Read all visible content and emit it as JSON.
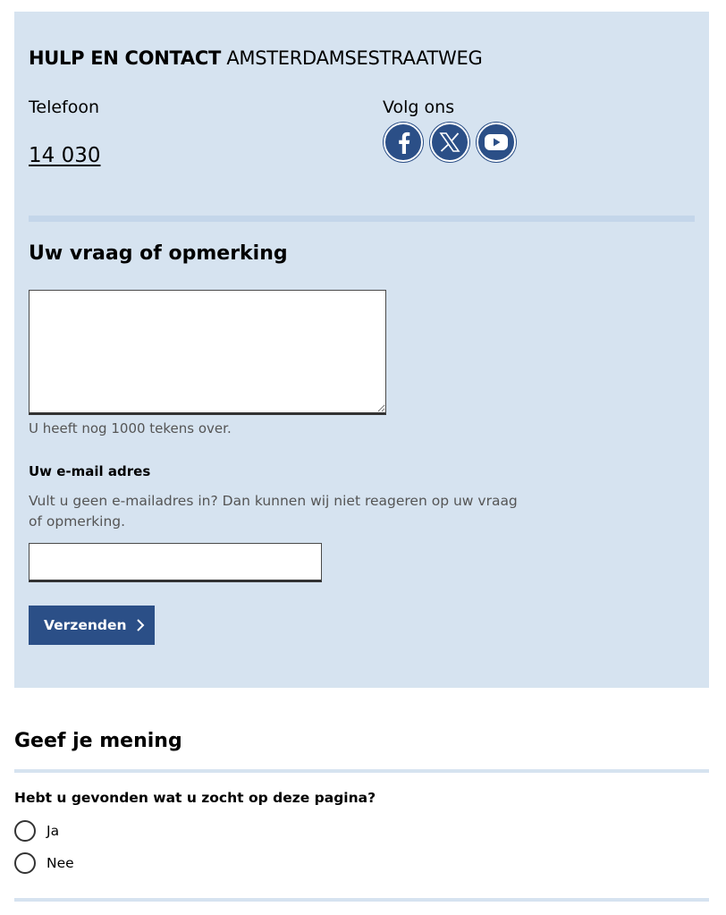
{
  "contact": {
    "title_bold": "HULP EN CONTACT",
    "title_location": "AMSTERDAMSESTRAATWEG",
    "phone_label": "Telefoon",
    "phone_number": "14 030",
    "follow_label": "Volg ons",
    "social": [
      {
        "icon": "facebook-icon"
      },
      {
        "icon": "x-twitter-icon"
      },
      {
        "icon": "youtube-icon"
      }
    ]
  },
  "form": {
    "title": "Uw vraag of opmerking",
    "textarea_value": "",
    "counter_text": "U heeft nog 1000 tekens over.",
    "email_label": "Uw e-mail adres",
    "email_help": "Vult u geen e-mailadres in? Dan kunnen wij niet reageren op uw vraag of opmerking.",
    "email_value": "",
    "submit_label": "Verzenden"
  },
  "feedback": {
    "title": "Geef je mening",
    "question": "Hebt u gevonden wat u zocht op deze pagina?",
    "options": [
      {
        "label": "Ja"
      },
      {
        "label": "Nee"
      }
    ]
  },
  "colors": {
    "panel_bg": "#d6e3f0",
    "accent": "#2b4f87"
  }
}
